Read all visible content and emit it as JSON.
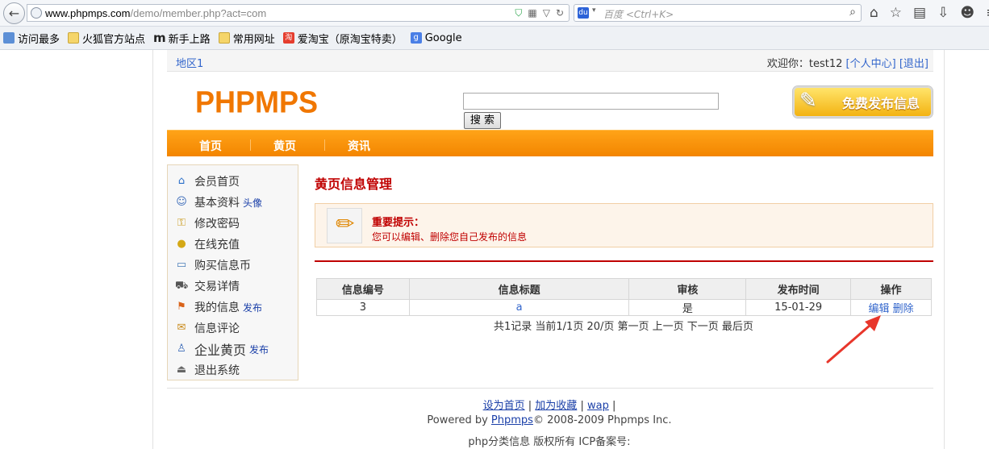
{
  "browser": {
    "url_prefix": "www.phpmps.com",
    "url_rest": "/demo/member.php?act=com",
    "search_placeholder": "百度 <Ctrl+K>",
    "bookmarks": [
      "访问最多",
      "火狐官方站点",
      "新手上路",
      "常用网址",
      "爱淘宝（原淘宝特卖）",
      "Google"
    ]
  },
  "topbar": {
    "region": "地区1",
    "welcome": "欢迎你：test12",
    "user_center": "[个人中心]",
    "logout": "[退出]"
  },
  "header": {
    "logo": "PHPMPS",
    "search_button": "搜 索",
    "post_button": "免费发布信息"
  },
  "mainnav": [
    "首页",
    "黄页",
    "资讯"
  ],
  "sidebar": {
    "items": [
      {
        "label": "会员首页",
        "extra": "",
        "icon": "home-icon"
      },
      {
        "label": "基本资料",
        "extra": "头像",
        "icon": "user-icon"
      },
      {
        "label": "修改密码",
        "extra": "",
        "icon": "key-icon"
      },
      {
        "label": "在线充值",
        "extra": "",
        "icon": "coins-icon"
      },
      {
        "label": "购买信息币",
        "extra": "",
        "icon": "card-icon"
      },
      {
        "label": "交易详情",
        "extra": "",
        "icon": "cart-icon"
      },
      {
        "label": "我的信息",
        "extra": "发布",
        "icon": "flag-icon"
      },
      {
        "label": "信息评论",
        "extra": "",
        "icon": "comment-icon"
      },
      {
        "label": "企业黄页",
        "extra": "发布",
        "icon": "company-icon"
      },
      {
        "label": "退出系统",
        "extra": "",
        "icon": "exit-icon"
      }
    ]
  },
  "content": {
    "title": "黄页信息管理",
    "notice_title": "重要提示：",
    "notice_text": "您可以编辑、删除您自己发布的信息",
    "table": {
      "headers": [
        "信息编号",
        "信息标题",
        "审核",
        "发布时间",
        "操作"
      ],
      "rows": [
        {
          "id": "3",
          "title": "a",
          "audit": "是",
          "date": "15-01-29",
          "edit": "编辑",
          "delete": "删除"
        }
      ]
    },
    "pager": "共1记录  当前1/1页  20/页    第一页 上一页 下一页 最后页"
  },
  "footer": {
    "set_home": "设为首页",
    "add_fav": "加为收藏",
    "wap": "wap",
    "powered_prefix": "Powered by ",
    "powered_link": "Phpmps",
    "powered_suffix": "© 2008-2009 Phpmps Inc.",
    "icp": "php分类信息 版权所有   ICP备案号:"
  },
  "colors": {
    "accent_orange": "#f38500",
    "notice_red": "#c00000",
    "link_blue": "#3366cc",
    "arrow_red": "#e8362b"
  }
}
